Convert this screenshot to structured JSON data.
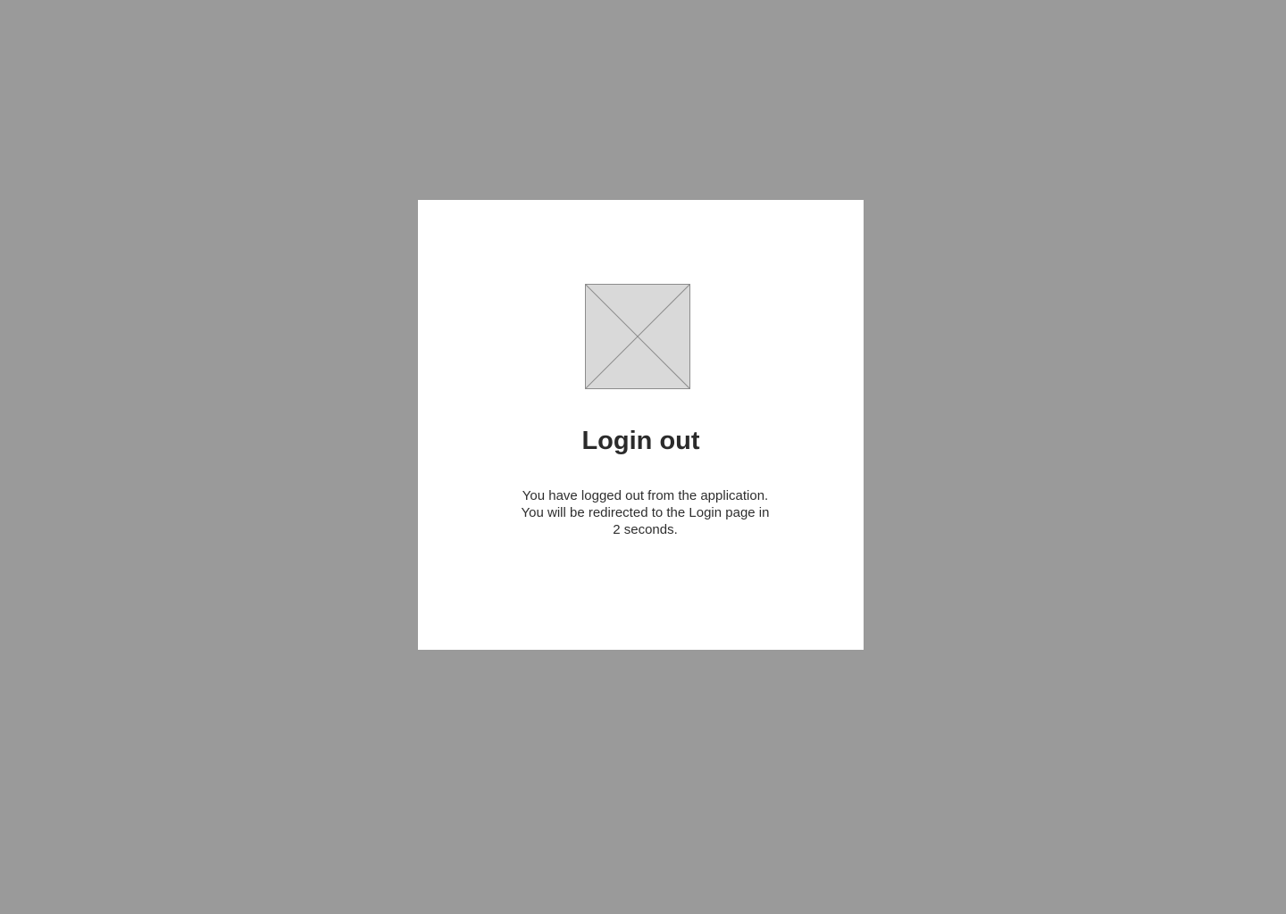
{
  "dialog": {
    "title": "Login out",
    "message_lines": [
      "You have logged out from the application.",
      "You will be redirected to the Login page in",
      "2 seconds."
    ],
    "image_icon": "image-placeholder-icon"
  },
  "colors": {
    "backdrop": "#9a9a9a",
    "dialog_background": "#ffffff",
    "placeholder_fill": "#d9d9d9",
    "placeholder_stroke": "#8c8c8c",
    "text": "#2b2b2b"
  }
}
